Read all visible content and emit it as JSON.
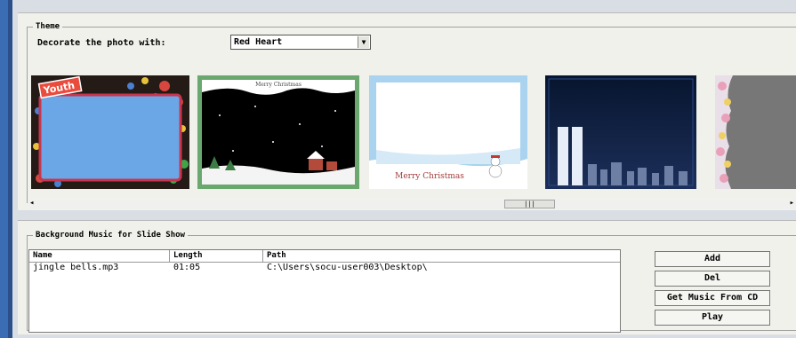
{
  "theme": {
    "legend": "Theme",
    "decorate_label": "Decorate the photo with:",
    "selected_decoration": "Red Heart",
    "thumbnails": [
      {
        "name": "Youth",
        "caption": "Youth"
      },
      {
        "name": "Merry Christmas night",
        "caption": "Merry Christmas"
      },
      {
        "name": "Merry Christmas snow",
        "caption": "Merry Christmas"
      },
      {
        "name": "City night",
        "caption": ""
      },
      {
        "name": "Flowers",
        "caption": ""
      }
    ],
    "selected_thumbnail_index": 1,
    "scroll_left": "◂",
    "scroll_right": "▸",
    "scroll_thumb": "|||"
  },
  "music": {
    "legend": "Background Music for Slide Show",
    "columns": [
      "Name",
      "Length",
      "Path"
    ],
    "rows": [
      {
        "name": "jingle bells.mp3",
        "length": "01:05",
        "path": "C:\\Users\\socu-user003\\Desktop\\"
      }
    ],
    "buttons": {
      "add": "Add",
      "del": "Del",
      "get_cd": "Get Music From CD",
      "play": "Play"
    }
  },
  "colors": {
    "selected_border": "#6aa86f",
    "thumb_frame_blue": "#a9d3ee"
  }
}
